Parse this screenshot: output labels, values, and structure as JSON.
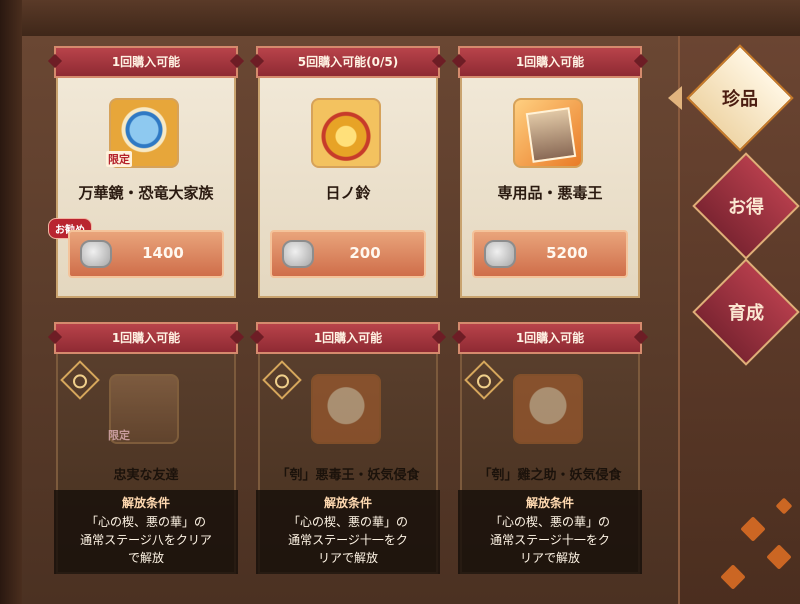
{
  "items": [
    {
      "limit": "1回購入可能",
      "name": "万華鏡・恐竜大家族",
      "badge": "限定",
      "recommend": "お勧め",
      "price": "1400",
      "icon": "kaleidoscope-mirror-icon"
    },
    {
      "limit": "5回購入可能(0/5)",
      "name": "日ノ鈴",
      "price": "200",
      "icon": "golden-bell-icon"
    },
    {
      "limit": "1回購入可能",
      "name": "専用品・悪毒王",
      "price": "5200",
      "icon": "portrait-card-icon"
    },
    {
      "limit": "1回購入可能",
      "name": "忠実な友達",
      "badge": "限定",
      "unlock_title": "解放条件",
      "unlock_text": [
        "「心の楔、悪の華」の",
        "通常ステージ八をクリア",
        "で解放"
      ],
      "icon": "fox-mirror-icon"
    },
    {
      "limit": "1回購入可能",
      "name": "「刳」悪毒王・妖気侵食",
      "unlock_title": "解放条件",
      "unlock_text": [
        "「心の楔、悪の華」の",
        "通常ステージ十一をク",
        "リアで解放"
      ],
      "icon": "orange-mirror-icon"
    },
    {
      "limit": "1回購入可能",
      "name": "「刳」雞之助・妖気侵食",
      "unlock_title": "解放条件",
      "unlock_text": [
        "「心の楔、悪の華」の",
        "通常ステージ十一をク",
        "リアで解放"
      ],
      "icon": "orange-mirror-icon"
    }
  ],
  "tabs": [
    {
      "label": "珍品",
      "active": true
    },
    {
      "label": "お得",
      "active": false
    },
    {
      "label": "育成",
      "active": false
    }
  ],
  "colors": {
    "accent": "#b8434a",
    "gold": "#d6a25a",
    "background": "#4b3122"
  }
}
